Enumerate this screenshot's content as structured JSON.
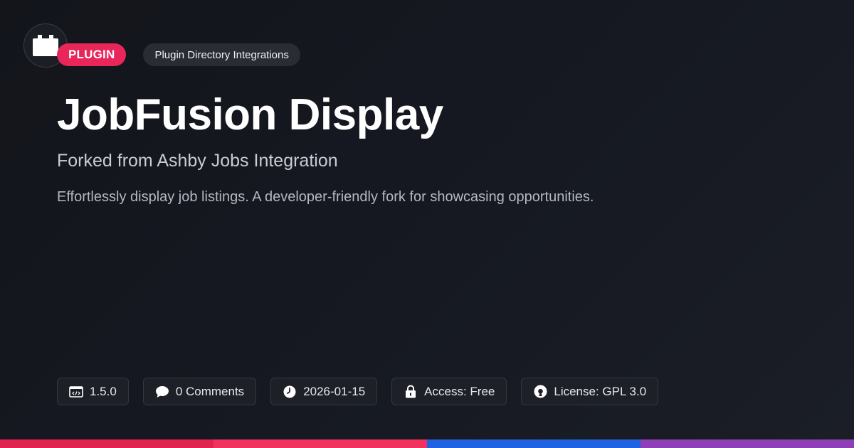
{
  "logo": {
    "icon": "plugin-block-icon"
  },
  "badges": {
    "type_label": "PLUGIN",
    "category_label": "Plugin Directory Integrations"
  },
  "header": {
    "title": "JobFusion Display",
    "subtitle": "Forked from Ashby Jobs Integration",
    "description": "Effortlessly display job listings. A developer-friendly fork for showcasing opportunities."
  },
  "meta": [
    {
      "icon": "code-window-icon",
      "label": "1.5.0"
    },
    {
      "icon": "comment-bubble-icon",
      "label": "0 Comments"
    },
    {
      "icon": "clock-icon",
      "label": "2026-01-15"
    },
    {
      "icon": "lock-icon",
      "label": "Access: Free"
    },
    {
      "icon": "open-source-icon",
      "label": "License: GPL 3.0"
    }
  ],
  "colors": {
    "accent": "#e8265a",
    "bar": [
      "#e0244f",
      "#f2325e",
      "#1f63e0",
      "#8e3fb8"
    ]
  }
}
